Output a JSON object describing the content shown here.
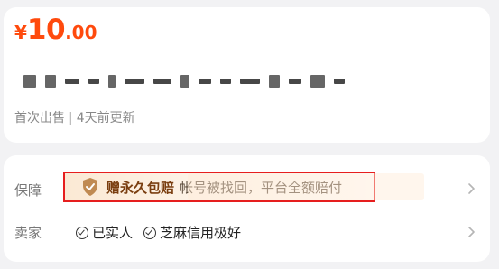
{
  "listing": {
    "price_symbol": "¥",
    "price_integer": "10",
    "price_decimal": ".00",
    "status_first_sale": "首次出售",
    "separator": "|",
    "updated": "4天前更新"
  },
  "guarantee": {
    "label": "保障",
    "title": "赠永久包赔",
    "description": "帐号被找回，平台全额赔付",
    "icon": "shield-check-icon"
  },
  "seller": {
    "label": "卖家",
    "badges": [
      "已实人",
      "芝麻信用极好"
    ]
  },
  "colors": {
    "price": "#ff4a0d",
    "highlight_border": "#e61e1e"
  }
}
